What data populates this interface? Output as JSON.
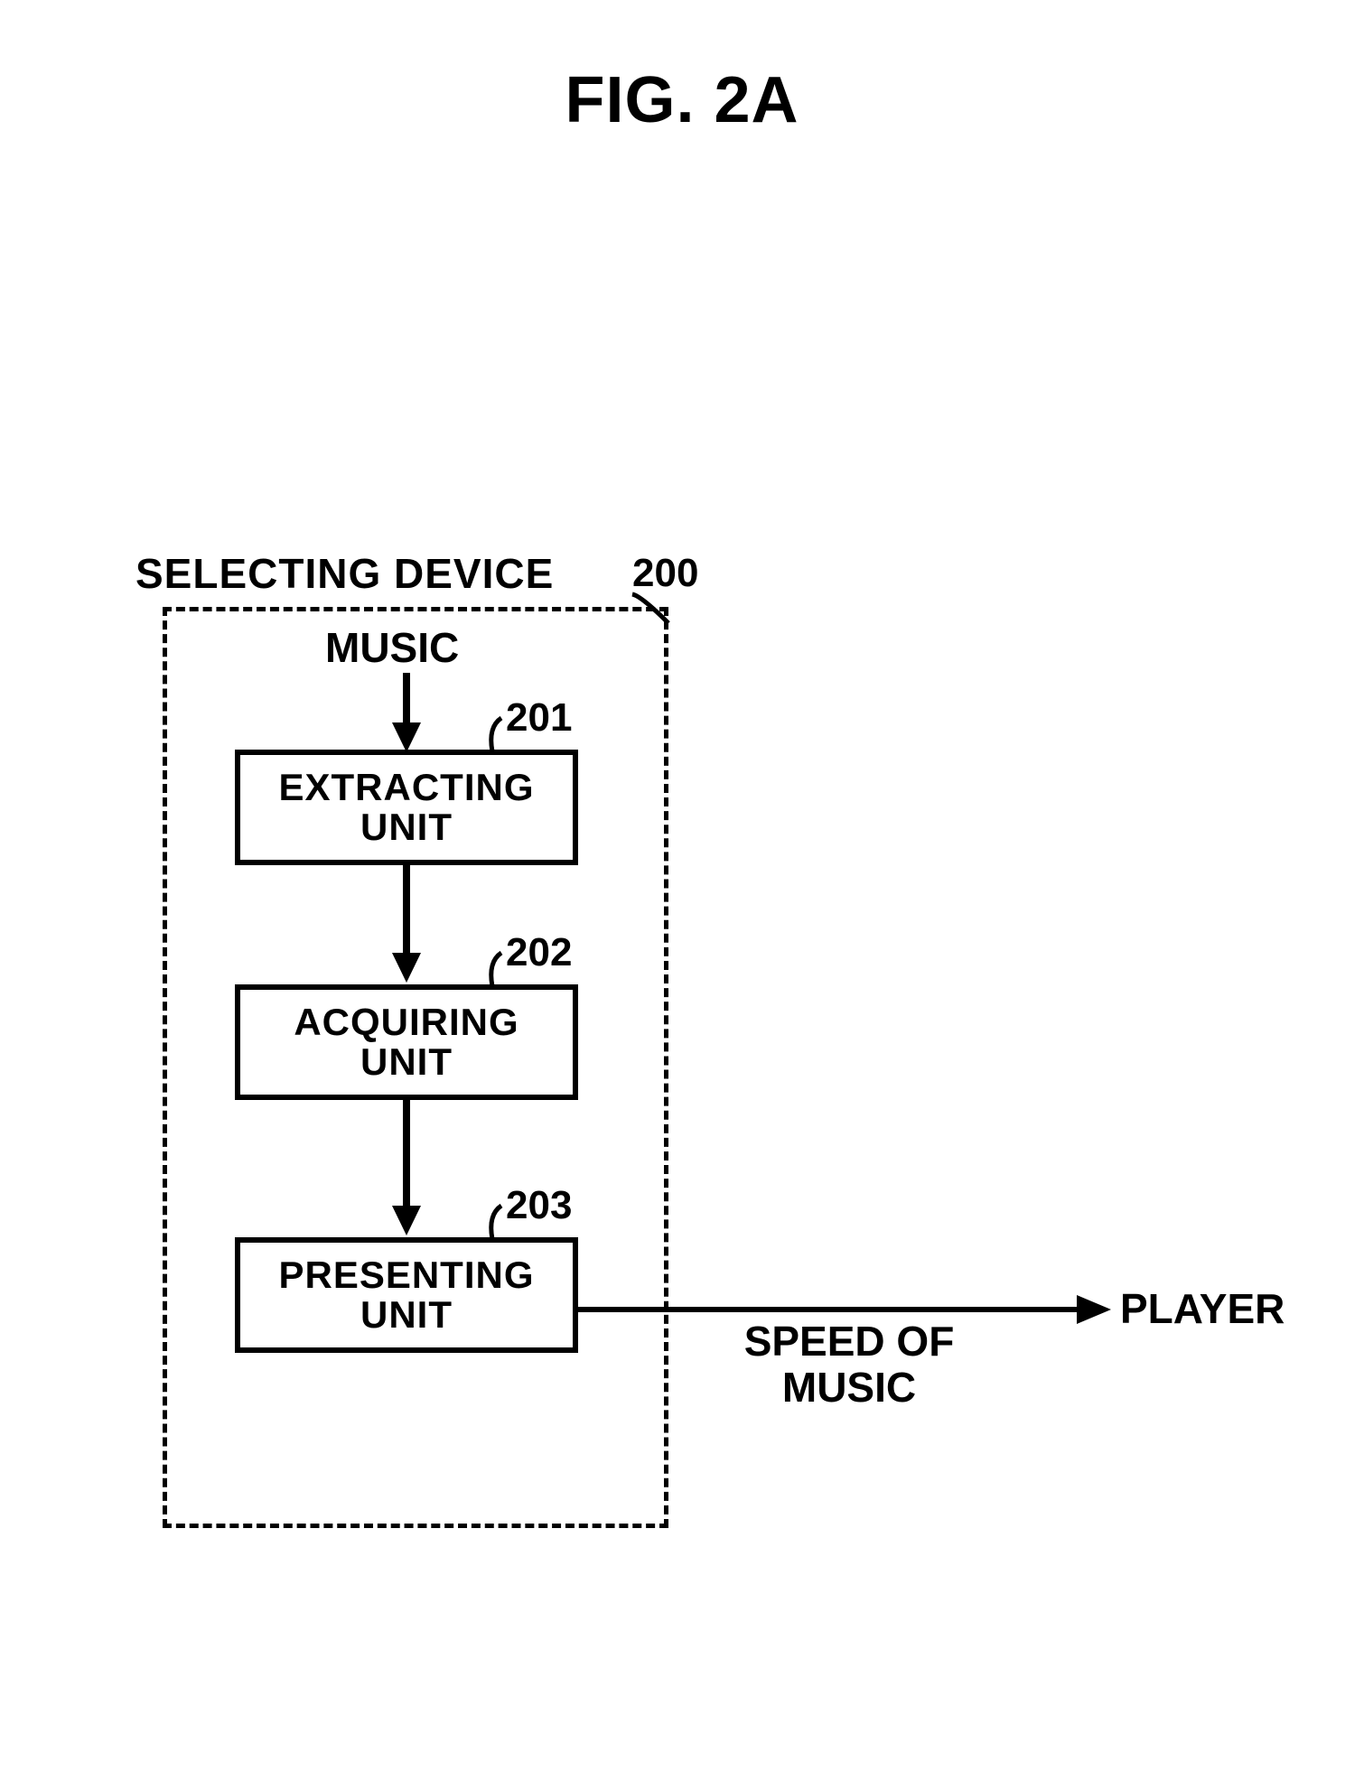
{
  "title": "FIG. 2A",
  "selecting_label": "SELECTING DEVICE",
  "device_num": "200",
  "input_label": "MUSIC",
  "units": {
    "extract": {
      "num": "201",
      "line1": "EXTRACTING",
      "line2": "UNIT"
    },
    "acquire": {
      "num": "202",
      "line1": "ACQUIRING",
      "line2": "UNIT"
    },
    "present": {
      "num": "203",
      "line1": "PRESENTING",
      "line2": "UNIT"
    }
  },
  "output_line1": "SPEED OF",
  "output_line2": "MUSIC",
  "receiver": "PLAYER"
}
